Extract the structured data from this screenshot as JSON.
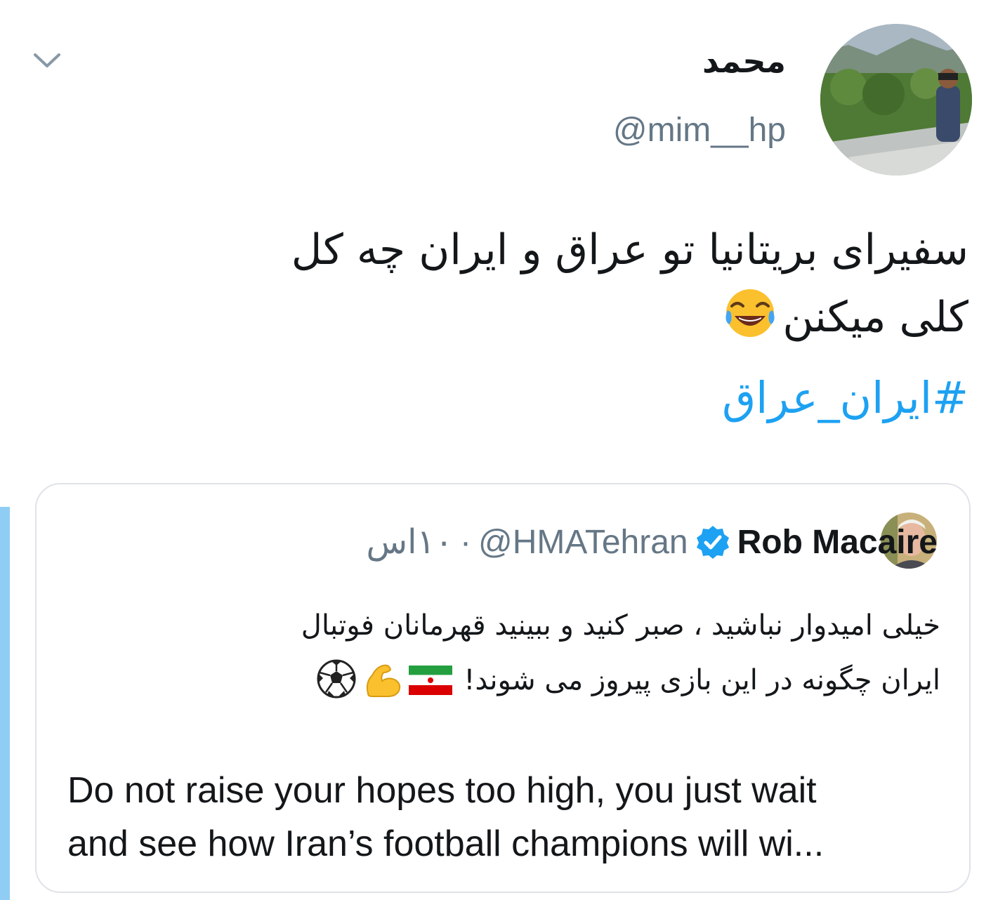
{
  "tweet": {
    "display_name": "محمد",
    "handle": "@mim__hp",
    "text_line1": "سفیرای بریتانیا تو عراق و ایران چه کل",
    "text_line2": "کلی میکنن",
    "hashtag": "#ایران_عراق",
    "avatar_icon": "profile-photo-landscape",
    "menu_icon": "chevron-down-icon",
    "emoji": "face-with-tears-of-joy"
  },
  "quoted": {
    "name": "Rob Macaire",
    "handle": "@HMATehran",
    "separator": "·",
    "time": "۱۰اس",
    "verified_icon": "verified-badge-icon",
    "fa_line1": "خیلی امیدوار نباشید ، صبر کنید و ببینید قهرمانان فوتبال",
    "fa_line2": "ایران چگونه در این بازی  پیروز می شوند!",
    "emojis": [
      "iran-flag",
      "flexed-biceps",
      "soccer-ball"
    ],
    "en_line1": "Do not raise your hopes too high, you just wait",
    "en_line2": "and see how Iran’s football champions will wi..."
  },
  "colors": {
    "accent": "#1da1f2",
    "muted": "#657786",
    "text": "#14171a",
    "border": "#dfe3e8",
    "left_accent": "#8fcdf5"
  }
}
